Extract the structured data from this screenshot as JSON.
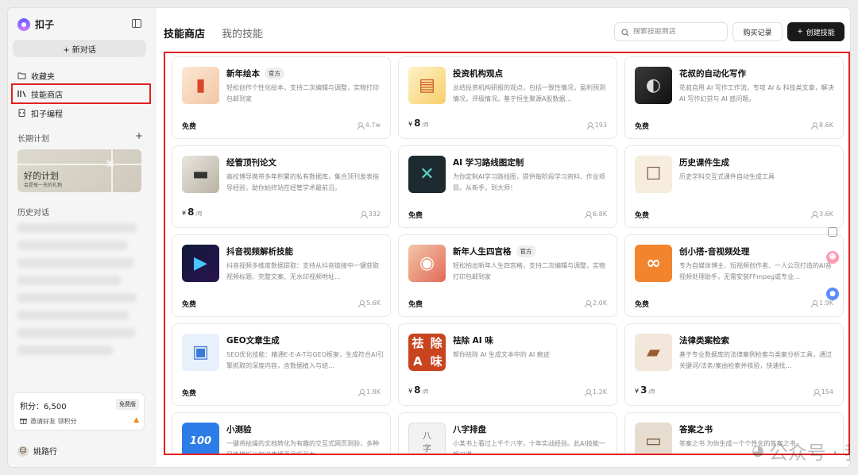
{
  "app": {
    "name": "扣子"
  },
  "sidebar": {
    "new_chat": "+ 新对话",
    "nav": [
      {
        "label": "收藏夹",
        "icon": "folder-icon"
      },
      {
        "label": "技能商店",
        "icon": "bookshelf-icon"
      },
      {
        "label": "扣子编程",
        "icon": "code-file-icon"
      }
    ],
    "long_term_plan_title": "长期计划",
    "plan_card": {
      "title": "好的计划",
      "subtitle": "会是每一天的礼物"
    },
    "history_title": "历史对话",
    "points": {
      "label": "积分：6,500",
      "badge": "免费版",
      "invite": "邀请好友 领积分"
    },
    "user": {
      "name": "姚路行"
    }
  },
  "header": {
    "tabs": [
      "技能商店",
      "我的技能"
    ],
    "search_placeholder": "搜索技能商店",
    "purchase_history": "购买记录",
    "create_skill": "创建技能"
  },
  "cards": [
    {
      "title": "新年绘本",
      "official": "官方",
      "desc": "轻松创作个性化绘本，支持二次编辑与调整，实物打印包邮到家",
      "price_type": "free",
      "price_label": "免费",
      "count": "4.7w",
      "thumb": "storybook"
    },
    {
      "title": "投资机构观点",
      "official": "",
      "desc": "总结投资机构研报的观点，包括一致性情况，盈利预测情况，评级情况。基于恒生聚源A股数据…",
      "price_type": "paid",
      "currency": "¥",
      "price": "8",
      "unit": "/月",
      "count": "193",
      "thumb": "report"
    },
    {
      "title": "花叔的自动化写作",
      "official": "",
      "desc": "花叔自用 AI 写作工作流，专攻 AI & 科技类文章，解决 AI 写作幻觉与 AI 感问题。",
      "price_type": "free",
      "price_label": "免费",
      "count": "8.6K",
      "thumb": "portrait"
    },
    {
      "title": "经管顶刊论文",
      "official": "",
      "desc": "高校博导携带多年积累的私有数据库，集合顶刊发表指导经验，助你始终站在经管学术最前沿。",
      "price_type": "paid",
      "currency": "¥",
      "price": "8",
      "unit": "/月",
      "count": "332",
      "thumb": "papers"
    },
    {
      "title": "AI 学习路线图定制",
      "official": "",
      "desc": "为你定制AI学习路线图，提供每阶段学习资料、作业项目。从新手，到大师！",
      "price_type": "free",
      "price_label": "免费",
      "count": "6.8K",
      "thumb": "tools"
    },
    {
      "title": "历史课件生成",
      "official": "",
      "desc": "历史学科交互式课件自动生成工具",
      "price_type": "free",
      "price_label": "免费",
      "count": "3.6K",
      "thumb": "history"
    },
    {
      "title": "抖音视频解析技能",
      "official": "",
      "desc": "抖音视频多维度数据提取：支持从抖音链接中一键获取视频标题、完整文案、无水印视频地址…",
      "price_type": "free",
      "price_label": "免费",
      "count": "5.6K",
      "thumb": "video"
    },
    {
      "title": "新年人生四宫格",
      "official": "官方",
      "desc": "轻松拍出新年人生四宫格，支持二次编辑与调整，实物打印包邮到家",
      "price_type": "free",
      "price_label": "免费",
      "count": "2.0K",
      "thumb": "camera"
    },
    {
      "title": "创小搭-音视频处理",
      "official": "",
      "desc": "专为自媒体博主、短视频创作者、一人公司打造的AI音视频处理助手，无需安装FFmpeg或专业…",
      "price_type": "free",
      "price_label": "免费",
      "count": "1.9K",
      "thumb": "ai-logo"
    },
    {
      "title": "GEO文章生成",
      "official": "",
      "desc": "SEO优化技能：精通E-E-A-T与GEO框架，生成符合AI引擎抓取的深度内容，含数据植入与结…",
      "price_type": "free",
      "price_label": "免费",
      "count": "1.8K",
      "thumb": "geo"
    },
    {
      "title": "祛除 AI 味",
      "official": "",
      "desc": "帮你祛除 AI 生成文本中的 AI 痕迹",
      "price_type": "paid",
      "currency": "¥",
      "price": "8",
      "unit": "/月",
      "count": "1.2K",
      "thumb": "remove-ai",
      "thumb_text": [
        "祛",
        "除",
        "A",
        "味"
      ]
    },
    {
      "title": "法律类案检索",
      "official": "",
      "desc": "基于专业数据库的法律案例检索与类案分析工具，通过关键词/法条/案由检索并核验，快速找…",
      "price_type": "paid",
      "currency": "¥",
      "price": "3",
      "unit": "/月",
      "count": "154",
      "thumb": "law"
    },
    {
      "title": "小测验",
      "official": "",
      "desc": "一键将枯燥的文档转化为有趣的交互式网页测验，多种风格模板让知识传播更具吸引力",
      "price_type": "free",
      "price_label": "",
      "count": "",
      "thumb": "quiz",
      "thumb_text": [
        "100"
      ]
    },
    {
      "title": "八字排盘",
      "official": "",
      "desc": "小某书上看过上千个八字，十年实战经验。此AI技能一朝习得",
      "price_type": "free",
      "price_label": "",
      "count": "",
      "thumb": "bazi",
      "thumb_text": [
        "八",
        "字"
      ]
    },
    {
      "title": "答案之书",
      "official": "",
      "desc": "答案之书 为你生成一个个性化的答案之书",
      "price_type": "free",
      "price_label": "",
      "count": "",
      "thumb": "answer-book"
    }
  ],
  "watermark": "公众号 · 我姚学AI",
  "colors": {
    "highlight": "#e02020",
    "primary_button": "#1a1a1a"
  }
}
